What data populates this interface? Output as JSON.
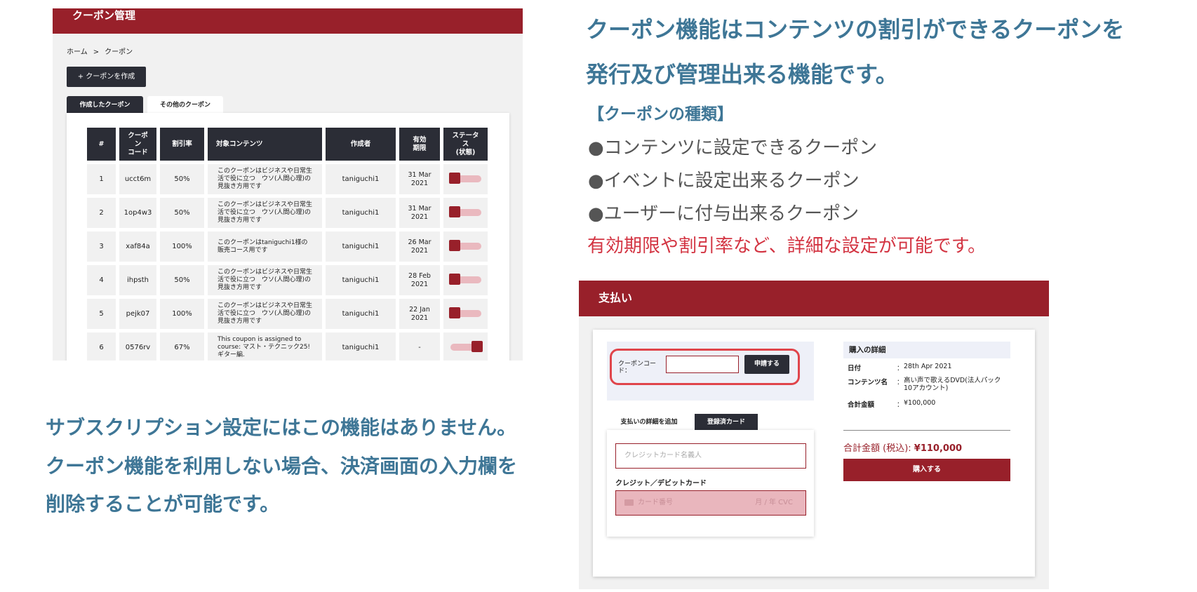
{
  "colors": {
    "brand_red": "#98202a",
    "dark": "#2b2d36",
    "heading_blue": "#3e7696",
    "note_red": "#d33442"
  },
  "admin": {
    "title": "クーポン管理",
    "breadcrumb": {
      "home": "ホーム",
      "sep": ">",
      "current": "クーポン"
    },
    "create_button": "+ クーポンを作成",
    "tabs": [
      "作成したクーポン",
      "その他のクーポン"
    ],
    "columns": [
      "#",
      "クーポ\nン\nコード",
      "割引率",
      "対象コンテンツ",
      "作成者",
      "有効\n期限",
      "ステータ\nス\n(状態)"
    ],
    "rows": [
      {
        "no": "1",
        "code": "ucct6m",
        "rate": "50%",
        "content": "このクーポンはビジネスや日常生活で役に立つ　ウソ(人間心理)の見抜き方用です",
        "author": "taniguchi1",
        "deadline": "31 Mar\n2021",
        "status": "off"
      },
      {
        "no": "2",
        "code": "1op4w3",
        "rate": "50%",
        "content": "このクーポンはビジネスや日常生活で役に立つ　ウソ(人間心理)の見抜き方用です",
        "author": "taniguchi1",
        "deadline": "31 Mar\n2021",
        "status": "off"
      },
      {
        "no": "3",
        "code": "xaf84a",
        "rate": "100%",
        "content": "このクーポンはtaniguchi1様の販売コース用です",
        "author": "taniguchi1",
        "deadline": "26 Mar\n2021",
        "status": "off"
      },
      {
        "no": "4",
        "code": "ihpsth",
        "rate": "50%",
        "content": "このクーポンはビジネスや日常生活で役に立つ　ウソ(人間心理)の見抜き方用です",
        "author": "taniguchi1",
        "deadline": "28 Feb\n2021",
        "status": "off"
      },
      {
        "no": "5",
        "code": "pejk07",
        "rate": "100%",
        "content": "このクーポンはビジネスや日常生活で役に立つ　ウソ(人間心理)の見抜き方用です",
        "author": "taniguchi1",
        "deadline": "22 Jan\n2021",
        "status": "off"
      },
      {
        "no": "6",
        "code": "0576rv",
        "rate": "67%",
        "content": "This coupon is assigned to course: マスト・テクニック25! ギター編.",
        "author": "taniguchi1",
        "deadline": "-",
        "status": "on"
      }
    ]
  },
  "intro": {
    "headline_line1": "クーポン機能はコンテンツの割引ができるクーポンを",
    "headline_line2": "発行及び管理出来る機能です。",
    "types_title": "【クーポンの種類】",
    "types": [
      "●コンテンツに設定できるクーポン",
      "●イベントに設定出来るクーポン",
      "●ユーザーに付与出来るクーポン"
    ],
    "note": "有効期限や割引率など、詳細な設定が可能です。"
  },
  "subscription_note": [
    "サブスクリプション設定にはこの機能はありません。",
    "クーポン機能を利用しない場合、決済画面の入力欄を",
    "削除することが可能です。"
  ],
  "payment": {
    "title": "支払い",
    "coupon_label": "クーポンコード：",
    "coupon_value": "",
    "apply_button": "申請する",
    "tabs": [
      "支払いの詳細を追加",
      "登録済カード"
    ],
    "cardholder_placeholder": "クレジットカード名義人",
    "card_label": "クレジット／デビットカード",
    "card_number_placeholder": "カード番号",
    "card_expiry_cvc_placeholder": "月 / 年  CVC",
    "details": {
      "title": "購入の詳細",
      "date_label": "日付",
      "date_value": "28th Apr 2021",
      "content_label": "コンテンツ名",
      "content_value": "高い声で歌えるDVD(法人パック10アカウント)",
      "total_label": "合計金額",
      "total_value": "¥100,000",
      "total_tax_label": "合計金額 (税込):",
      "total_tax_value": "¥110,000"
    },
    "buy_button": "購入する",
    "colon": "："
  }
}
